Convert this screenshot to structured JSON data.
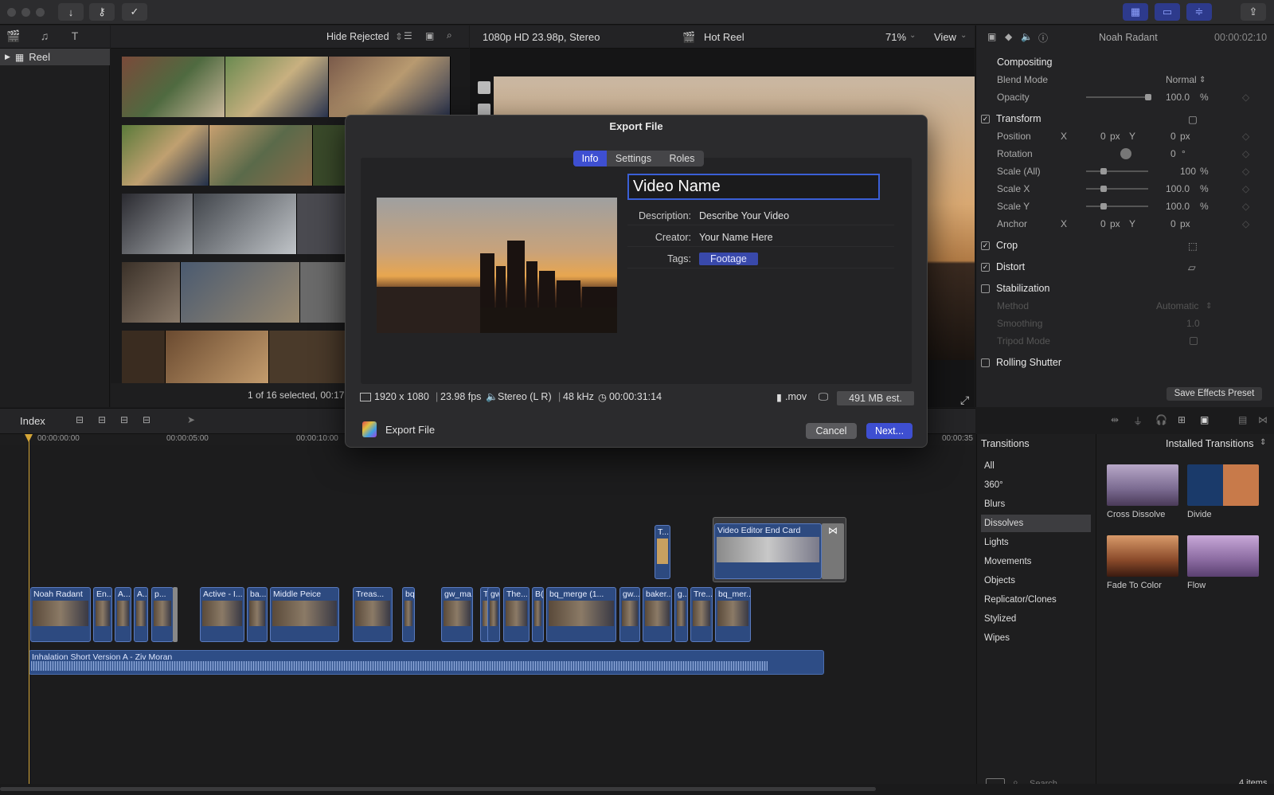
{
  "toolbar": {
    "icons": [
      "import-icon",
      "key-icon",
      "check-icon",
      "grid-view-icon",
      "filmstrip-icon",
      "sliders-icon",
      "share-icon"
    ]
  },
  "library": {
    "items": [
      {
        "label": "Reel"
      }
    ]
  },
  "browser": {
    "filter": "Hide Rejected",
    "footer": "1 of 16 selected, 00:17"
  },
  "viewer": {
    "format": "1080p HD 23.98p, Stereo",
    "project": "Hot Reel",
    "zoom": "71%",
    "view": "View"
  },
  "inspector": {
    "clip_name": "Noah Radant",
    "timecode": "00:00:02:10",
    "sections": {
      "compositing": "Compositing",
      "blend_label": "Blend Mode",
      "blend_value": "Normal",
      "opacity_label": "Opacity",
      "opacity_value": "100.0",
      "opacity_unit": "%",
      "transform": "Transform",
      "position_label": "Position",
      "pos_x_label": "X",
      "pos_x": "0",
      "pos_y_label": "Y",
      "pos_y": "0",
      "px": "px",
      "rotation_label": "Rotation",
      "rotation_value": "0",
      "deg": "°",
      "scale_all_label": "Scale (All)",
      "scale_all": "100",
      "scale_x_label": "Scale X",
      "scale_x": "100.0",
      "scale_y_label": "Scale Y",
      "scale_y": "100.0",
      "anchor_label": "Anchor",
      "anchor_x": "0",
      "anchor_y": "0",
      "crop": "Crop",
      "distort": "Distort",
      "stabilization": "Stabilization",
      "method_label": "Method",
      "method_value": "Automatic",
      "smoothing_label": "Smoothing",
      "smoothing_value": "1.0",
      "tripod_label": "Tripod Mode",
      "rolling_shutter": "Rolling Shutter"
    },
    "save_preset": "Save Effects Preset"
  },
  "timeline": {
    "index": "Index",
    "ticks": [
      "00:00:00:00",
      "00:00:05:00",
      "00:00:10:00",
      "00:00:35"
    ],
    "clips": [
      "Noah Radant",
      "En...",
      "A...",
      "A...",
      "p...",
      "Active - I...",
      "ba...",
      "Middle Peice",
      "Treas...",
      "bq...",
      "gw_ma...",
      "Tl",
      "gw_...",
      "The...",
      "B(",
      "bq_merge (1...",
      "gw...",
      "baker...",
      "g...",
      "Tre...",
      "bq_mer..."
    ],
    "connected": [
      "T...",
      "Video Editor End Card"
    ],
    "audio": "Inhalation   Short Version A - Ziv Moran"
  },
  "transitions": {
    "title": "Transitions",
    "installed": "Installed Transitions",
    "categories": [
      "All",
      "360°",
      "Blurs",
      "Dissolves",
      "Lights",
      "Movements",
      "Objects",
      "Replicator/Clones",
      "Stylized",
      "Wipes"
    ],
    "selected": "Dissolves",
    "tiles": [
      "Cross Dissolve",
      "Divide",
      "Fade To Color",
      "Flow"
    ],
    "search_placeholder": "Search",
    "count": "4 items"
  },
  "dialog": {
    "title": "Export File",
    "tabs": [
      "Info",
      "Settings",
      "Roles"
    ],
    "active_tab": "Info",
    "name": "Video Name",
    "description_label": "Description:",
    "description": "Describe Your Video",
    "creator_label": "Creator:",
    "creator": "Your Name Here",
    "tags_label": "Tags:",
    "tag": "Footage",
    "resolution": "1920 x 1080",
    "fps": "23.98 fps",
    "audio": "Stereo (L R)",
    "rate": "48 kHz",
    "duration": "00:00:31:14",
    "ext": ".mov",
    "size": "491 MB est.",
    "destination": "Export File",
    "cancel": "Cancel",
    "next": "Next..."
  },
  "colors": {
    "accent": "#3e4fd1",
    "clip": "#2d4a80",
    "playhead": "#d4a537"
  }
}
